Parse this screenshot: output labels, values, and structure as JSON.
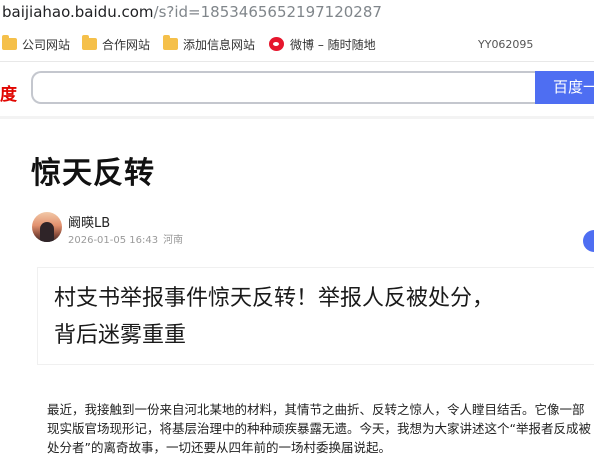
{
  "address_bar": {
    "host": "baijiahao.baidu.com",
    "path": "/s?id=1853465652197120287"
  },
  "bookmarks": {
    "items": [
      {
        "label": "公司网站",
        "icon": "folder-icon"
      },
      {
        "label": "合作网站",
        "icon": "folder-icon"
      },
      {
        "label": "添加信息网站",
        "icon": "folder-icon"
      },
      {
        "label": "微博 – 随时随地",
        "icon": "weibo-icon"
      }
    ],
    "code": "YY062095"
  },
  "search": {
    "logo_fragment": "度",
    "input_value": "",
    "button_label": "百度一下"
  },
  "article": {
    "title": "惊天反转",
    "author": "阚暎LB",
    "datetime": "2026-01-05 16:43",
    "location": "河南",
    "banner_lines": [
      "村支书举报事件惊天反转！举报人反被处分，",
      "背后迷雾重重"
    ],
    "paragraph": "最近，我接触到一份来自河北某地的材料，其情节之曲折、反转之惊人，令人瞠目结舌。它像一部现实版官场现形记，将基层治理中的种种顽疾暴露无遗。今天，我想为大家讲述这个“举报者反成被处分者”的离奇故事，一切还要从四年前的一场村委换届说起。"
  },
  "colors": {
    "accent": "#4e6ef2",
    "baidu_red": "#e10601",
    "folder": "#f5c04a"
  }
}
